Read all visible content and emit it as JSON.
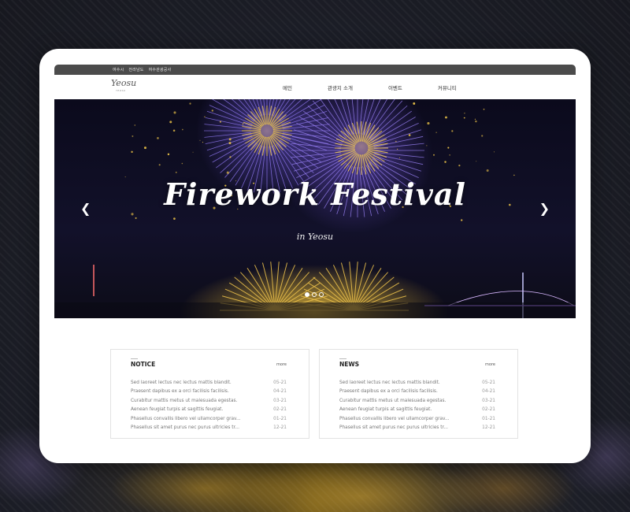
{
  "topbar": {
    "links": [
      "여수시",
      "전라남도",
      "여수관광공사"
    ]
  },
  "logo": {
    "script": "Yeosu",
    "sub": "YEOSU"
  },
  "nav": {
    "items": [
      "메인",
      "관광지 소개",
      "이벤트",
      "커뮤니티"
    ]
  },
  "hero": {
    "title": "Firework Festival",
    "subtitle": "in Yeosu",
    "prev_icon": "chevron-left-icon",
    "next_icon": "chevron-right-icon",
    "slides": 3,
    "active_slide": 1
  },
  "notice": {
    "title": "NOTICE",
    "more": "more",
    "rows": [
      {
        "text": "Sed laoreet lectus nec lectus mattis blandit.",
        "date": "05-21"
      },
      {
        "text": "Praesent dapibus ex a orci facilisis facilisis.",
        "date": "04-21"
      },
      {
        "text": "Curabitur mattis metus ut malesuada egestas.",
        "date": "03-21"
      },
      {
        "text": "Aenean feugiat turpis at sagittis feugiat.",
        "date": "02-21"
      },
      {
        "text": "Phasellus convallis libero vel ullamcorper grav...",
        "date": "01-21"
      },
      {
        "text": "Phasellus sit amet purus nec purus ultricies tr...",
        "date": "12-21"
      }
    ]
  },
  "news": {
    "title": "NEWS",
    "more": "more",
    "rows": [
      {
        "text": "Sed laoreet lectus nec lectus mattis blandit.",
        "date": "05-21"
      },
      {
        "text": "Praesent dapibus ex a orci facilisis facilisis.",
        "date": "04-21"
      },
      {
        "text": "Curabitur mattis metus ut malesuada egestas.",
        "date": "03-21"
      },
      {
        "text": "Aenean feugiat turpis at sagittis feugiat.",
        "date": "02-21"
      },
      {
        "text": "Phasellus convallis libero vel ullamcorper grav...",
        "date": "01-21"
      },
      {
        "text": "Phasellus sit amet purus nec purus ultricies tr...",
        "date": "12-21"
      }
    ]
  },
  "colors": {
    "topbar": "#4b4b4b",
    "hero_bg": "#0b0a1c",
    "firework_gold": "#e6be46",
    "firework_purple": "#7a5ae6"
  }
}
